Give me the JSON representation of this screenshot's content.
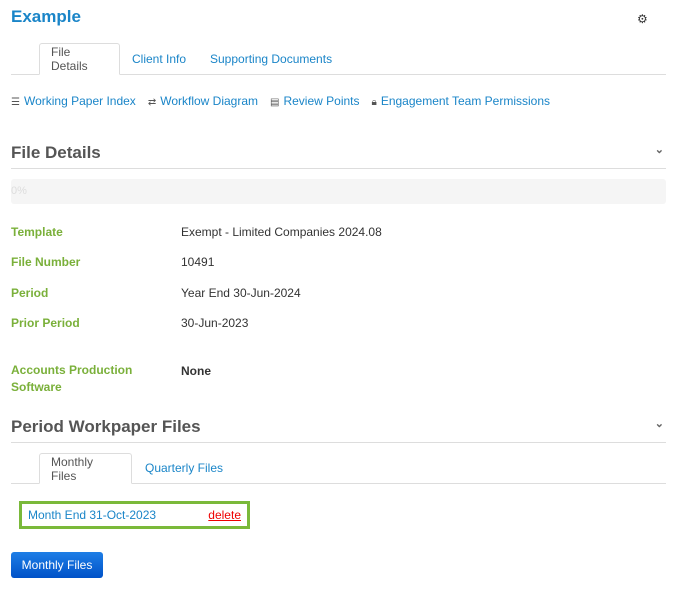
{
  "header": {
    "title": "Example",
    "settings_icon": "gear-icon"
  },
  "tabs": [
    {
      "label": "File Details",
      "active": true
    },
    {
      "label": "Client Info"
    },
    {
      "label": "Supporting Documents"
    }
  ],
  "links": [
    {
      "label": "Working Paper Index",
      "icon": "list-icon"
    },
    {
      "label": "Workflow Diagram",
      "icon": "retweet-icon"
    },
    {
      "label": "Review Points",
      "icon": "server-icon"
    },
    {
      "label": "Engagement Team Permissions",
      "icon": "lock-icon"
    }
  ],
  "file_details": {
    "heading": "File Details",
    "progress": {
      "percent": 0,
      "label": "0%"
    },
    "fields": [
      {
        "label": "Template",
        "value": "Exempt - Limited Companies 2024.08"
      },
      {
        "label": "File Number",
        "value": "10491"
      },
      {
        "label": "Period",
        "value": "Year End 30-Jun-2024"
      },
      {
        "label": "Prior Period",
        "value": "30-Jun-2023"
      },
      {
        "label": "Accounts Production Software",
        "value": "None"
      }
    ]
  },
  "workpapers": {
    "heading": "Period Workpaper Files",
    "tabs": [
      {
        "label": "Monthly Files",
        "active": true
      },
      {
        "label": "Quarterly Files"
      }
    ],
    "files": [
      {
        "name": "Month End 31-Oct-2023",
        "delete_label": "delete"
      }
    ],
    "button_label": "Monthly Files"
  }
}
